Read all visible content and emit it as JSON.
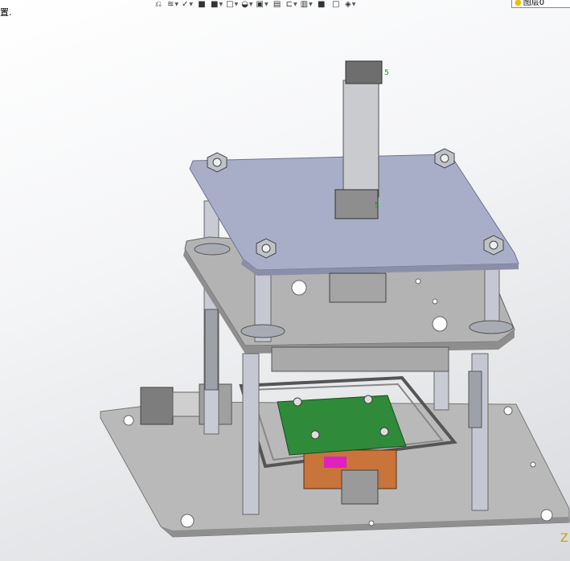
{
  "status": {
    "left_text": "置."
  },
  "toolbar": {
    "items": [
      {
        "name": "undo-icon",
        "glyph": "⎌",
        "caret": false
      },
      {
        "name": "layers-icon",
        "glyph": "≋",
        "caret": true
      },
      {
        "name": "pin-icon",
        "glyph": "✓",
        "caret": true
      },
      {
        "name": "cube-solid-icon",
        "glyph": "■",
        "caret": false
      },
      {
        "name": "cube-shaded-icon",
        "glyph": "■",
        "caret": true
      },
      {
        "name": "cube-wire-icon",
        "glyph": "□",
        "caret": true
      },
      {
        "name": "sphere-icon",
        "glyph": "◒",
        "caret": true
      },
      {
        "name": "render-icon",
        "glyph": "▣",
        "caret": true
      },
      {
        "name": "document-icon",
        "glyph": "▤",
        "caret": false
      },
      {
        "name": "section-icon",
        "glyph": "⊏",
        "caret": true
      },
      {
        "name": "display-icon",
        "glyph": "▥",
        "caret": true
      },
      {
        "name": "color-swatch-icon",
        "glyph": "■",
        "caret": false
      },
      {
        "name": "plane-icon",
        "glyph": "□",
        "caret": false
      },
      {
        "name": "appearance-icon",
        "glyph": "◈",
        "caret": true
      }
    ],
    "layer_label": "图层0"
  },
  "triad": {
    "z_label": "Z"
  },
  "colors": {
    "plate": "#a9aec8",
    "plate_edge": "#8a8fa8",
    "base": "#b8b8b8",
    "pillar": "#c5c8d2",
    "pcb": "#2f8a3a",
    "copper": "#c8743a"
  }
}
